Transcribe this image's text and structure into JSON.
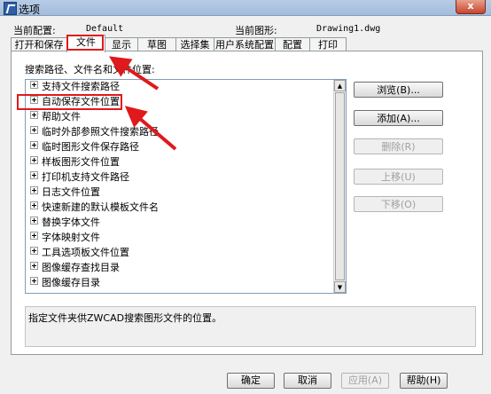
{
  "window": {
    "title": "选项",
    "close_glyph": "x"
  },
  "profile": {
    "current_config_label": "当前配置:",
    "current_config_value": "Default",
    "current_drawing_label": "当前图形:",
    "current_drawing_value": "Drawing1.dwg"
  },
  "tabs": [
    {
      "label": "打开和保存"
    },
    {
      "label": "文件",
      "active": true
    },
    {
      "label": "显示"
    },
    {
      "label": "草图"
    },
    {
      "label": "选择集"
    },
    {
      "label": "用户系统配置"
    },
    {
      "label": "配置"
    },
    {
      "label": "打印"
    }
  ],
  "files": {
    "section_label": "搜索路径、文件名和文件位置:",
    "tree_items": [
      "支持文件搜索路径",
      "自动保存文件位置",
      "帮助文件",
      "临时外部参照文件搜索路径",
      "临时图形文件保存路径",
      "样板图形文件位置",
      "打印机支持文件路径",
      "日志文件位置",
      "快速新建的默认模板文件名",
      "替换字体文件",
      "字体映射文件",
      "工具选项板文件位置",
      "图像缓存查找目录",
      "图像缓存目录"
    ],
    "description": "指定文件夹供ZWCAD搜索图形文件的位置。"
  },
  "side_buttons": {
    "browse": "浏览(B)...",
    "add": "添加(A)...",
    "delete": "删除(R)",
    "move_up": "上移(U)",
    "move_down": "下移(O)"
  },
  "footer": {
    "ok": "确定",
    "cancel": "取消",
    "apply": "应用(A)",
    "help": "帮助(H)"
  },
  "icons": {
    "expand": "plus-expander-icon",
    "app": "zwcad-app-icon"
  },
  "colors": {
    "annotation_red": "#e0191c",
    "titlebar": "#b7cce6"
  }
}
